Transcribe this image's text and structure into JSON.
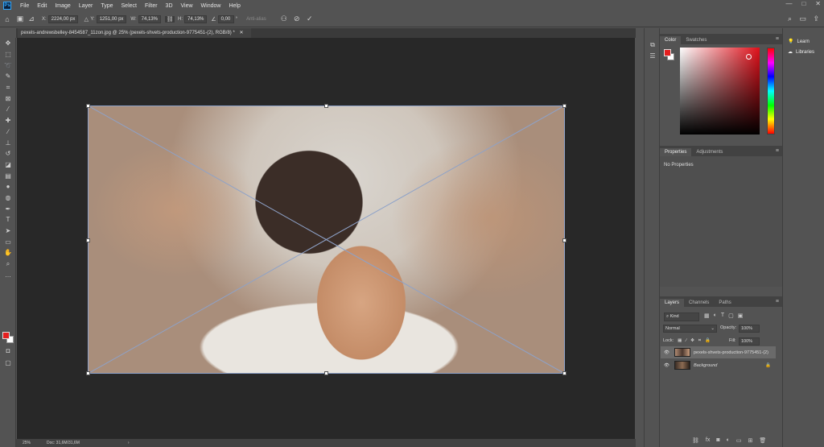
{
  "app": {
    "logo": "Ps",
    "menus": [
      "File",
      "Edit",
      "Image",
      "Layer",
      "Type",
      "Select",
      "Filter",
      "3D",
      "View",
      "Window",
      "Help"
    ],
    "window_controls": [
      "—",
      "□",
      "✕"
    ]
  },
  "options_bar": {
    "x_label": "X:",
    "x_value": "2224,00 px",
    "y_label": "Y:",
    "y_value": "1251,00 px",
    "w_label": "W:",
    "w_value": "74,13%",
    "h_label": "H:",
    "h_value": "74,13%",
    "angle_value": "0,00",
    "angle_unit": "°",
    "antialias_label": "Anti-alias"
  },
  "document": {
    "tab_title": "pexels-andrewsbelley-8454587_11zon.jpg @ 25% (pexels-shvets-production-9775451-(2), RGB/8) *",
    "zoom": "25%",
    "doc_info": "Doc: 31,6M/31,6M"
  },
  "color_panel": {
    "tabs": [
      "Color",
      "Swatches"
    ],
    "fg_color": "#e41f1f",
    "bg_color": "#ffffff"
  },
  "properties_panel": {
    "tabs": [
      "Properties",
      "Adjustments"
    ],
    "message": "No Properties"
  },
  "layers_panel": {
    "tabs": [
      "Layers",
      "Channels",
      "Paths"
    ],
    "search_kind": "Kind",
    "blend_mode": "Normal",
    "opacity_label": "Opacity:",
    "opacity_value": "100%",
    "lock_label": "Lock:",
    "fill_label": "Fill:",
    "fill_value": "100%",
    "layers": [
      {
        "name": "pexels-shvets-production-9775451-(2)",
        "selected": true
      },
      {
        "name": "Background",
        "selected": false
      }
    ]
  },
  "learn_panel": {
    "items": [
      "Learn",
      "Libraries"
    ]
  }
}
